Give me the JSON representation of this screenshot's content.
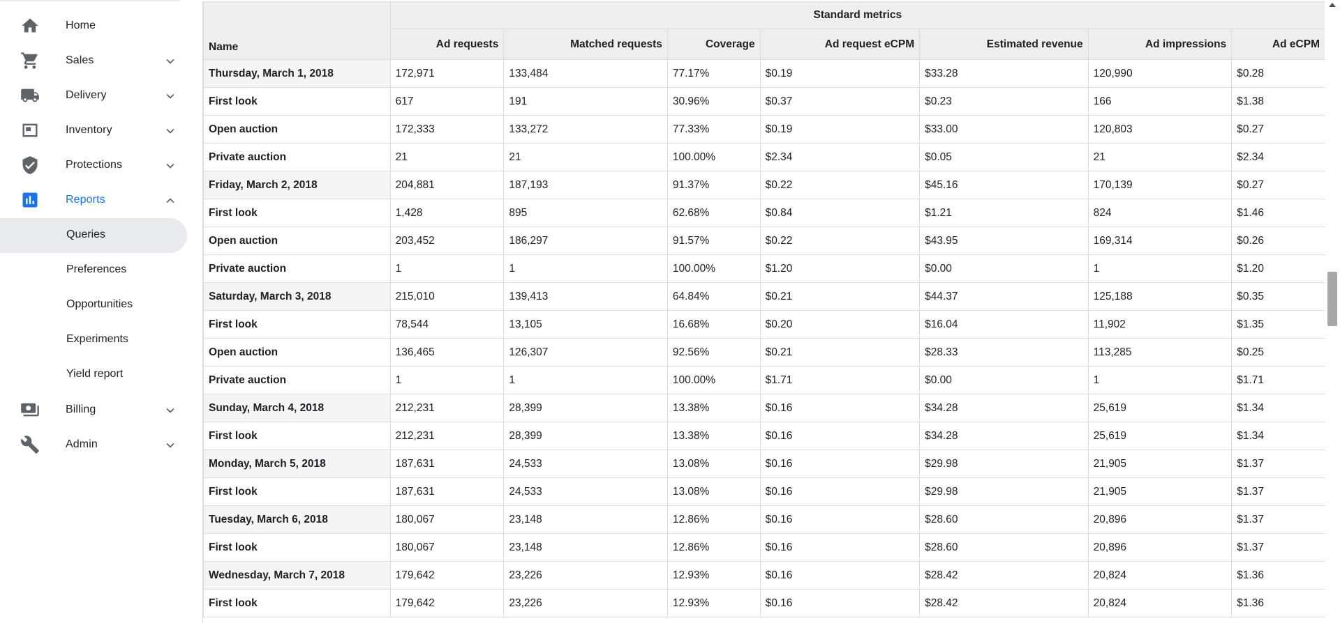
{
  "sidebar": {
    "items": [
      {
        "label": "Home",
        "icon": "home-icon",
        "expandable": false
      },
      {
        "label": "Sales",
        "icon": "cart-icon",
        "expandable": true
      },
      {
        "label": "Delivery",
        "icon": "truck-icon",
        "expandable": true
      },
      {
        "label": "Inventory",
        "icon": "inventory-icon",
        "expandable": true
      },
      {
        "label": "Protections",
        "icon": "shield-icon",
        "expandable": true
      },
      {
        "label": "Reports",
        "icon": "bar-chart-icon",
        "expandable": true,
        "expanded": true
      },
      {
        "label": "Billing",
        "icon": "money-icon",
        "expandable": true
      },
      {
        "label": "Admin",
        "icon": "wrench-icon",
        "expandable": true
      }
    ],
    "reports_children": [
      {
        "label": "Queries",
        "selected": true
      },
      {
        "label": "Preferences"
      },
      {
        "label": "Opportunities"
      },
      {
        "label": "Experiments"
      },
      {
        "label": "Yield report"
      }
    ]
  },
  "colors": {
    "accent": "#1a73e8",
    "icon": "#5f6368",
    "header_bg": "#eeeeee",
    "selected_bg": "#e8eaed"
  },
  "report": {
    "group_header": "Standard metrics",
    "name_header": "Name",
    "columns": [
      "Ad requests",
      "Matched requests",
      "Coverage",
      "Ad request eCPM",
      "Estimated revenue",
      "Ad impressions",
      "Ad eCPM"
    ],
    "rows": [
      {
        "type": "date",
        "name": "Thursday, March 1, 2018",
        "values": [
          "172,971",
          "133,484",
          "77.17%",
          "$0.19",
          "$33.28",
          "120,990",
          "$0.28"
        ]
      },
      {
        "type": "sub",
        "name": "First look",
        "values": [
          "617",
          "191",
          "30.96%",
          "$0.37",
          "$0.23",
          "166",
          "$1.38"
        ]
      },
      {
        "type": "sub",
        "name": "Open auction",
        "values": [
          "172,333",
          "133,272",
          "77.33%",
          "$0.19",
          "$33.00",
          "120,803",
          "$0.27"
        ]
      },
      {
        "type": "sub",
        "name": "Private auction",
        "values": [
          "21",
          "21",
          "100.00%",
          "$2.34",
          "$0.05",
          "21",
          "$2.34"
        ]
      },
      {
        "type": "date",
        "name": "Friday, March 2, 2018",
        "values": [
          "204,881",
          "187,193",
          "91.37%",
          "$0.22",
          "$45.16",
          "170,139",
          "$0.27"
        ]
      },
      {
        "type": "sub",
        "name": "First look",
        "values": [
          "1,428",
          "895",
          "62.68%",
          "$0.84",
          "$1.21",
          "824",
          "$1.46"
        ]
      },
      {
        "type": "sub",
        "name": "Open auction",
        "values": [
          "203,452",
          "186,297",
          "91.57%",
          "$0.22",
          "$43.95",
          "169,314",
          "$0.26"
        ]
      },
      {
        "type": "sub",
        "name": "Private auction",
        "values": [
          "1",
          "1",
          "100.00%",
          "$1.20",
          "$0.00",
          "1",
          "$1.20"
        ]
      },
      {
        "type": "date",
        "name": "Saturday, March 3, 2018",
        "values": [
          "215,010",
          "139,413",
          "64.84%",
          "$0.21",
          "$44.37",
          "125,188",
          "$0.35"
        ]
      },
      {
        "type": "sub",
        "name": "First look",
        "values": [
          "78,544",
          "13,105",
          "16.68%",
          "$0.20",
          "$16.04",
          "11,902",
          "$1.35"
        ]
      },
      {
        "type": "sub",
        "name": "Open auction",
        "values": [
          "136,465",
          "126,307",
          "92.56%",
          "$0.21",
          "$28.33",
          "113,285",
          "$0.25"
        ]
      },
      {
        "type": "sub",
        "name": "Private auction",
        "values": [
          "1",
          "1",
          "100.00%",
          "$1.71",
          "$0.00",
          "1",
          "$1.71"
        ]
      },
      {
        "type": "date",
        "name": "Sunday, March 4, 2018",
        "values": [
          "212,231",
          "28,399",
          "13.38%",
          "$0.16",
          "$34.28",
          "25,619",
          "$1.34"
        ]
      },
      {
        "type": "sub",
        "name": "First look",
        "values": [
          "212,231",
          "28,399",
          "13.38%",
          "$0.16",
          "$34.28",
          "25,619",
          "$1.34"
        ]
      },
      {
        "type": "date",
        "name": "Monday, March 5, 2018",
        "values": [
          "187,631",
          "24,533",
          "13.08%",
          "$0.16",
          "$29.98",
          "21,905",
          "$1.37"
        ]
      },
      {
        "type": "sub",
        "name": "First look",
        "values": [
          "187,631",
          "24,533",
          "13.08%",
          "$0.16",
          "$29.98",
          "21,905",
          "$1.37"
        ]
      },
      {
        "type": "date",
        "name": "Tuesday, March 6, 2018",
        "values": [
          "180,067",
          "23,148",
          "12.86%",
          "$0.16",
          "$28.60",
          "20,896",
          "$1.37"
        ]
      },
      {
        "type": "sub",
        "name": "First look",
        "values": [
          "180,067",
          "23,148",
          "12.86%",
          "$0.16",
          "$28.60",
          "20,896",
          "$1.37"
        ]
      },
      {
        "type": "date",
        "name": "Wednesday, March 7, 2018",
        "values": [
          "179,642",
          "23,226",
          "12.93%",
          "$0.16",
          "$28.42",
          "20,824",
          "$1.36"
        ]
      },
      {
        "type": "sub",
        "name": "First look",
        "values": [
          "179,642",
          "23,226",
          "12.93%",
          "$0.16",
          "$28.42",
          "20,824",
          "$1.36"
        ]
      }
    ]
  }
}
